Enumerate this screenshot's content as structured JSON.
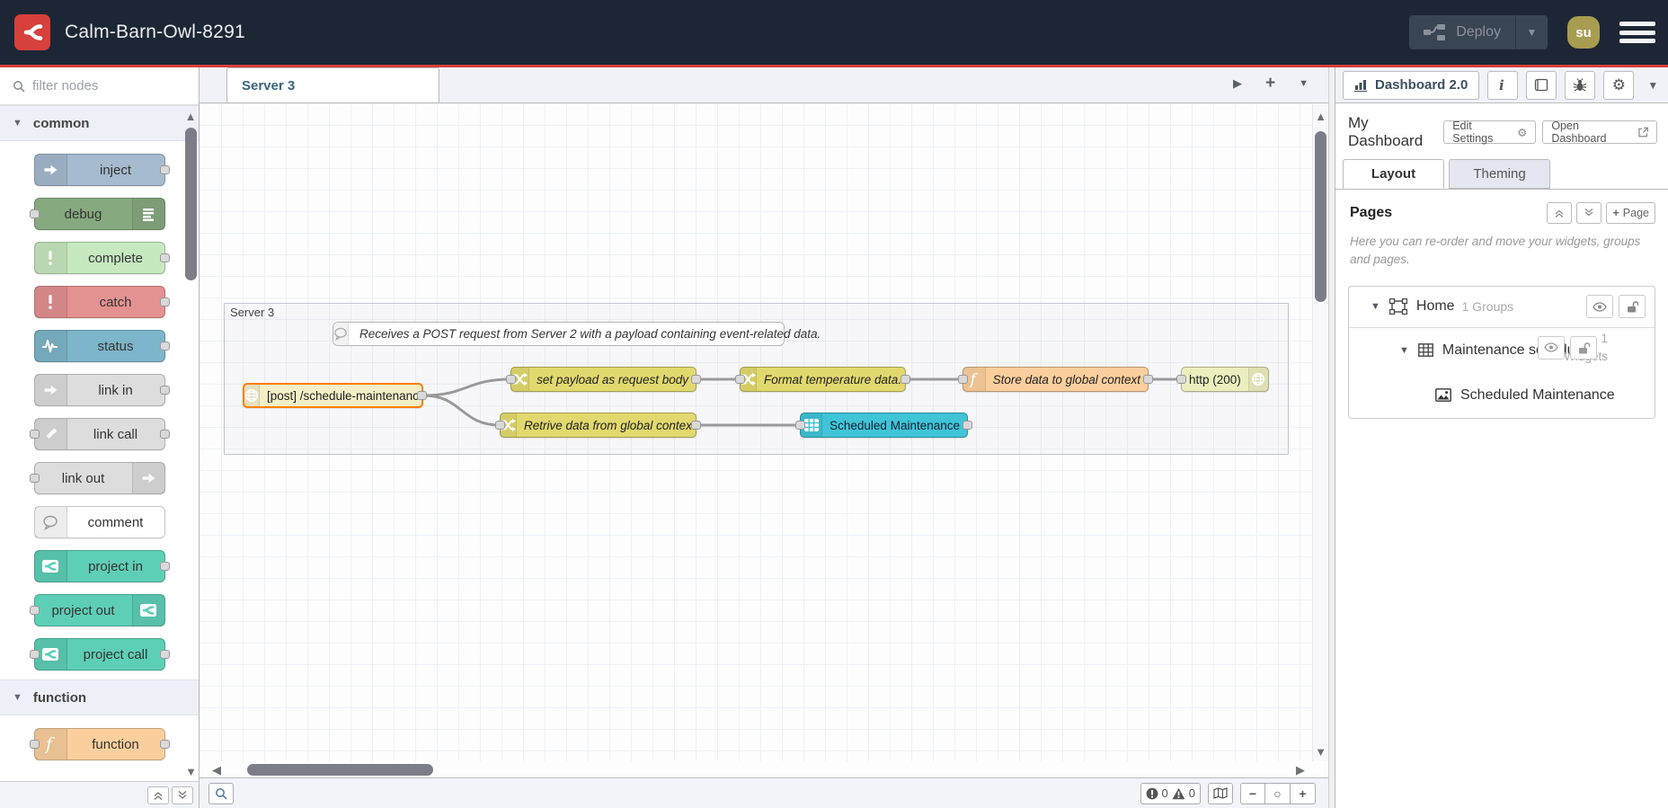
{
  "header": {
    "title": "Calm-Barn-Owl-8291",
    "deploy_label": "Deploy",
    "avatar_text": "su"
  },
  "palette": {
    "filter_placeholder": "filter nodes",
    "categories": [
      {
        "label": "common",
        "nodes": [
          {
            "label": "inject"
          },
          {
            "label": "debug"
          },
          {
            "label": "complete"
          },
          {
            "label": "catch"
          },
          {
            "label": "status"
          },
          {
            "label": "link in"
          },
          {
            "label": "link call"
          },
          {
            "label": "link out"
          },
          {
            "label": "comment"
          },
          {
            "label": "project in"
          },
          {
            "label": "project out"
          },
          {
            "label": "project call"
          }
        ]
      },
      {
        "label": "function",
        "nodes": [
          {
            "label": "function"
          }
        ]
      }
    ]
  },
  "workspace": {
    "tab": "Server 3"
  },
  "flow": {
    "group_label": "Server 3",
    "comment": "Receives a POST request from Server 2 with a payload containing event-related data.",
    "nodes": [
      {
        "label": "[post] /schedule-maintenance"
      },
      {
        "label": "set payload as request body"
      },
      {
        "label": "Format temperature data."
      },
      {
        "label": "Store data to global context"
      },
      {
        "label": "http (200)"
      },
      {
        "label": "Retrive data from global context"
      },
      {
        "label": "Scheduled Maintenance"
      }
    ]
  },
  "sidebar": {
    "tab_label": "Dashboard 2.0",
    "dashboard_name": "My Dashboard",
    "edit_settings_label": "Edit Settings",
    "open_dashboard_label": "Open Dashboard",
    "tabs": {
      "layout": "Layout",
      "theming": "Theming"
    },
    "pages": {
      "title": "Pages",
      "add_page_label": "Page",
      "help": "Here you can re-order and move your widgets, groups and pages.",
      "tree": {
        "page": {
          "name": "Home",
          "meta": "1 Groups"
        },
        "group": {
          "name": "Maintenance schedul...",
          "meta": "1 Widgets"
        },
        "widget": {
          "name": "Scheduled Maintenance"
        }
      }
    }
  },
  "statusbar": {
    "errors": "0",
    "warnings": "0"
  },
  "icons": [
    "node-red-logo-icon",
    "deploy-icon",
    "hamburger-icon",
    "search-icon",
    "chevron-down-icon",
    "inject-icon",
    "debug-icon",
    "exclamation-icon",
    "status-pulse-icon",
    "link-icon",
    "comment-bubble-icon",
    "project-icon",
    "function-icon",
    "globe-icon",
    "change-shuffle-icon",
    "table-icon",
    "bar-chart-icon",
    "info-icon",
    "book-icon",
    "bug-icon",
    "gear-icon",
    "external-link-icon",
    "collapse-all-icon",
    "expand-all-icon",
    "plus-icon",
    "artboard-icon",
    "eye-icon",
    "unlock-icon",
    "image-icon",
    "map-icon",
    "minus-icon",
    "circle-icon",
    "error-icon",
    "warning-icon",
    "caret-icon"
  ],
  "colors": {
    "header_bg": "#1d2635",
    "accent_red": "#d43f3a",
    "logo_red": "#d6413c",
    "inject": "#a6bbcf",
    "debug": "#87a980",
    "complete": "#c7e9c0",
    "catch": "#e49191",
    "status": "#7db5ca",
    "link": "#dddddd",
    "comment": "#ffffff",
    "project": "#5ecfb7",
    "function": "#fbcf9d",
    "http_in": "#f3efc7",
    "change": "#e2d96e",
    "http_response": "#eceebe",
    "table_widget": "#40c4d7",
    "wire": "#999999",
    "selected_border": "#ff8000",
    "avatar_bg": "#a89c50"
  }
}
